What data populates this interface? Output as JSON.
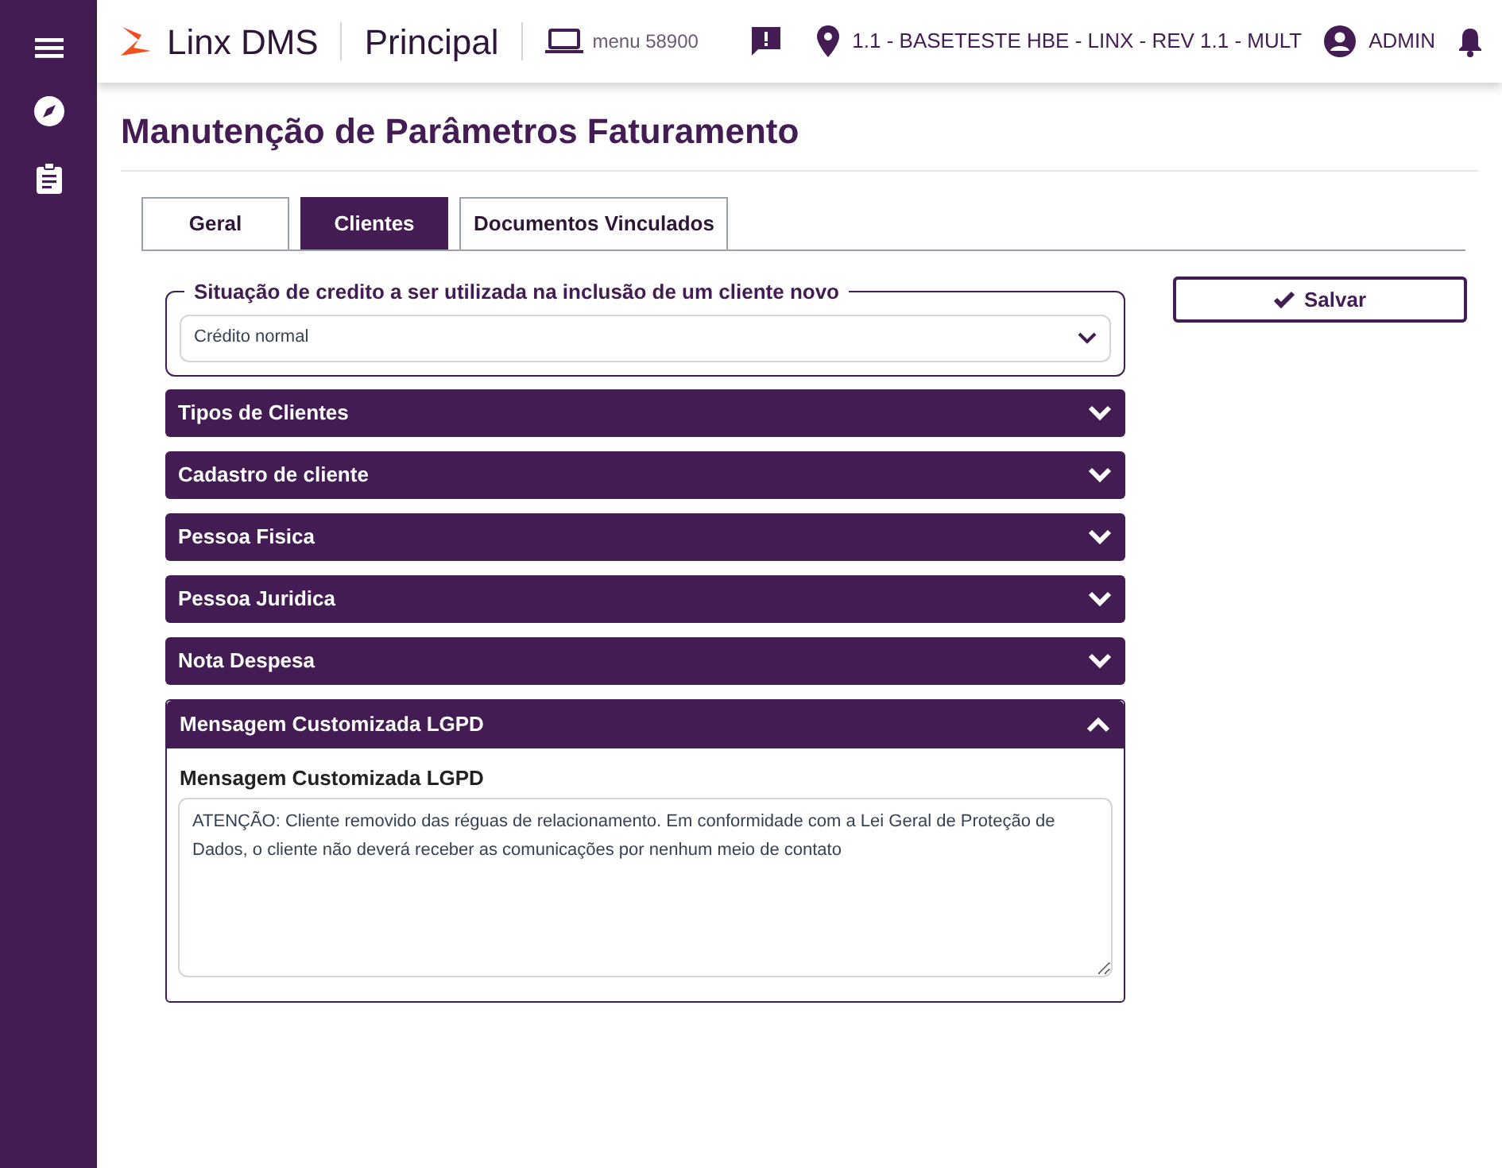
{
  "header": {
    "brand": "Linx DMS",
    "module": "Principal",
    "menu": "menu 58900",
    "location": "1.1 - BASETESTE HBE - LINX - REV 1.1 - MULT",
    "user": "ADMIN"
  },
  "page_title": "Manutenção de Parâmetros Faturamento",
  "tabs": [
    {
      "label": "Geral",
      "selected": false
    },
    {
      "label": "Clientes",
      "selected": true
    },
    {
      "label": "Documentos Vinculados",
      "selected": false
    }
  ],
  "credit_group": {
    "legend": "Situação de credito a ser utilizada na inclusão de um cliente novo",
    "value": "Crédito normal"
  },
  "save_button": "Salvar",
  "sections": [
    {
      "title": "Tipos de Clientes",
      "expanded": false
    },
    {
      "title": "Cadastro de cliente",
      "expanded": false
    },
    {
      "title": "Pessoa Fisica",
      "expanded": false
    },
    {
      "title": "Pessoa Juridica",
      "expanded": false
    },
    {
      "title": "Nota Despesa",
      "expanded": false
    },
    {
      "title": "Mensagem Customizada LGPD",
      "expanded": true,
      "field_label": "Mensagem Customizada LGPD",
      "field_value": "ATENÇÃO: Cliente removido das réguas de relacionamento. Em conformidade com a Lei Geral de Proteção de Dados, o cliente não deverá receber as comunicações por nenhum meio de contato"
    }
  ]
}
